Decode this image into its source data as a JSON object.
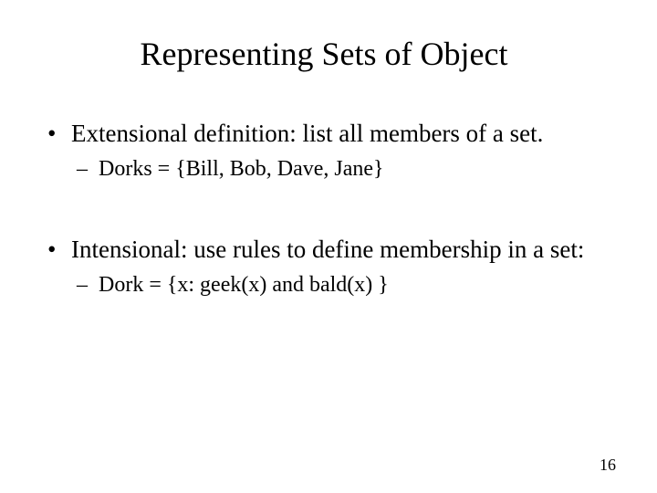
{
  "title": "Representing Sets of Object",
  "bullets": [
    {
      "text": "Extensional definition: list all members of a set.",
      "sub": "Dorks = {Bill, Bob, Dave, Jane}"
    },
    {
      "text": "Intensional: use rules to define membership in a set:",
      "sub": "Dork = {x: geek(x) and bald(x) }"
    }
  ],
  "page_number": "16"
}
